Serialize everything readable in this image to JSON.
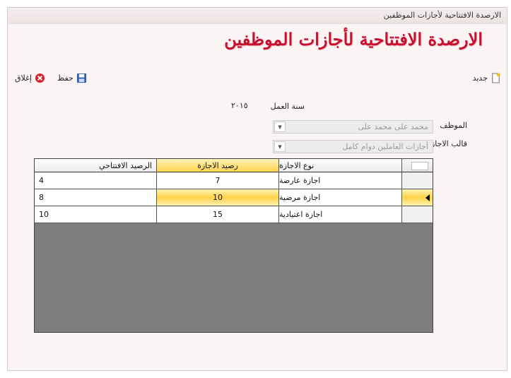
{
  "window": {
    "title": "الارصدة الافتتاحية لأجازات الموظفين"
  },
  "header": {
    "title": "الارصدة الافتتاحية لأجازات الموظفين"
  },
  "toolbar": {
    "new_label": "جديد",
    "save_label": "حفظ",
    "close_label": "إغلاق"
  },
  "form": {
    "year_label": "سنة العمل",
    "year_value": "٢٠١٥",
    "employee_label": "الموظف",
    "employee_value": "محمد على محمد على",
    "template_label": "قالب الاجازات",
    "template_value": "أجازات العاملين دوام كامل"
  },
  "grid": {
    "columns": [
      "نوع الاجازة",
      "رصيد الاجازة",
      "الرصيد الافتتاحي"
    ],
    "selected_row_index": 1,
    "rows": [
      {
        "type": "اجازة عارضة",
        "balance": "7",
        "opening": "4"
      },
      {
        "type": "اجازة مرضية",
        "balance": "10",
        "opening": "8"
      },
      {
        "type": "اجازة اعتيادية",
        "balance": "15",
        "opening": "10"
      }
    ]
  },
  "colors": {
    "title": "#c8102e",
    "selection": "#ffd24a",
    "grid_empty": "#7e7e7e"
  }
}
